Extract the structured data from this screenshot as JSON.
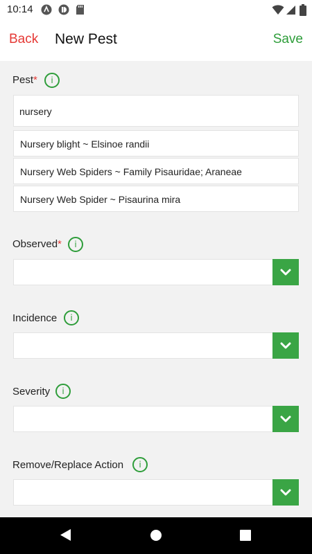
{
  "status_bar": {
    "time": "10:14"
  },
  "nav": {
    "back_label": "Back",
    "title": "New Pest",
    "save_label": "Save"
  },
  "form": {
    "pest": {
      "label": "Pest",
      "required_mark": "*",
      "info_icon": "i",
      "value": "nursery",
      "suggestions": [
        "Nursery blight ~ Elsinoe randii",
        "Nursery Web Spiders ~ Family Pisauridae; Araneae",
        "Nursery Web Spider ~ Pisaurina mira"
      ]
    },
    "observed": {
      "label": "Observed",
      "required_mark": "*",
      "info_icon": "i",
      "value": ""
    },
    "incidence": {
      "label": "Incidence",
      "info_icon": "i",
      "value": ""
    },
    "severity": {
      "label": "Severity",
      "info_icon": "i",
      "value": ""
    },
    "remove_replace": {
      "label": "Remove/Replace Action",
      "info_icon": "i",
      "value": ""
    }
  },
  "colors": {
    "accent_green": "#3aa545",
    "back_red": "#e53935",
    "save_green": "#2e9d3a"
  },
  "icons": [
    "wifi-icon",
    "signal-icon",
    "battery-icon",
    "chevron-down-icon",
    "back-triangle-icon",
    "home-circle-icon",
    "recents-square-icon"
  ]
}
